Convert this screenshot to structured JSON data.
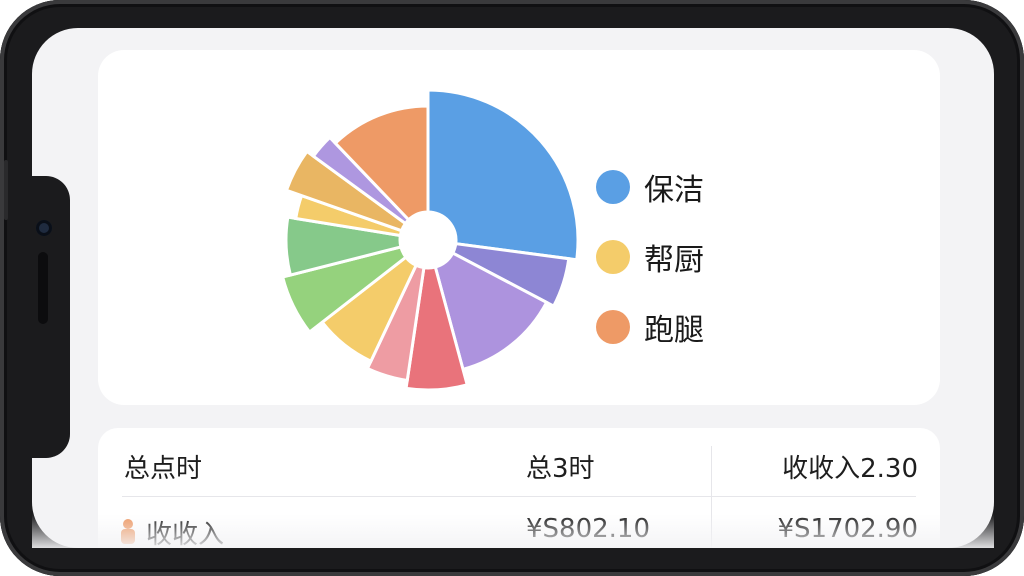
{
  "chart_data": {
    "type": "pie",
    "legend": [
      "保洁",
      "帮厨",
      "跑腿"
    ],
    "colors": {
      "保洁": "#5a9fe4",
      "帮厨": "#f4cc6a",
      "跑腿": "#ee9a66"
    },
    "slices": [
      {
        "value": 29,
        "color": "#5a9fe4"
      },
      {
        "value": 6,
        "color": "#8d86d4"
      },
      {
        "value": 14,
        "color": "#ad93de"
      },
      {
        "value": 7,
        "color": "#e9737b"
      },
      {
        "value": 5,
        "color": "#ee9ca3"
      },
      {
        "value": 8,
        "color": "#f4cc6a"
      },
      {
        "value": 7,
        "color": "#95d27d"
      },
      {
        "value": 7,
        "color": "#86c98a"
      },
      {
        "value": 3,
        "color": "#f4cc6a"
      },
      {
        "value": 5,
        "color": "#e9b663"
      },
      {
        "value": 3,
        "color": "#ae97e0"
      },
      {
        "value": 13,
        "color": "#ee9a66"
      }
    ]
  },
  "table": {
    "headers": [
      "总点时",
      "总3时",
      "收收入2.30"
    ],
    "rows": [
      {
        "name": "收收入",
        "col2": "¥S802.10",
        "col3": "¥S1702.90"
      }
    ]
  }
}
